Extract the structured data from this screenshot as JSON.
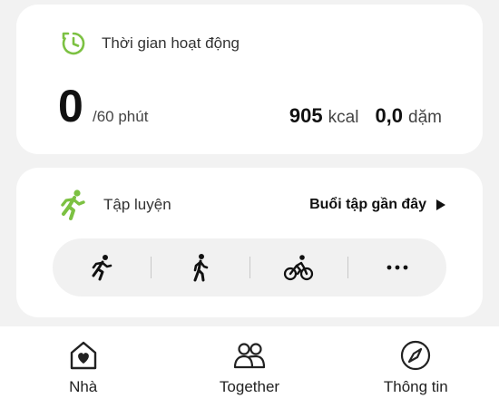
{
  "active_time": {
    "title": "Thời gian hoạt động",
    "value": "0",
    "goal": "/60 phút",
    "calories_value": "905",
    "calories_unit": "kcal",
    "distance_value": "0,0",
    "distance_unit": "dặm",
    "icon": "timer-icon",
    "accent_color": "#7cc142"
  },
  "workout": {
    "title": "Tập luyện",
    "recent_label": "Buổi tập gần đây",
    "icon": "running-icon",
    "activities": [
      {
        "icon": "running-icon"
      },
      {
        "icon": "walking-icon"
      },
      {
        "icon": "cycling-icon"
      },
      {
        "icon": "more-icon"
      }
    ]
  },
  "bottom_nav": {
    "items": [
      {
        "label": "Nhà",
        "icon": "home-heart-icon"
      },
      {
        "label": "Together",
        "icon": "people-icon"
      },
      {
        "label": "Thông tin",
        "icon": "compass-icon"
      }
    ]
  }
}
